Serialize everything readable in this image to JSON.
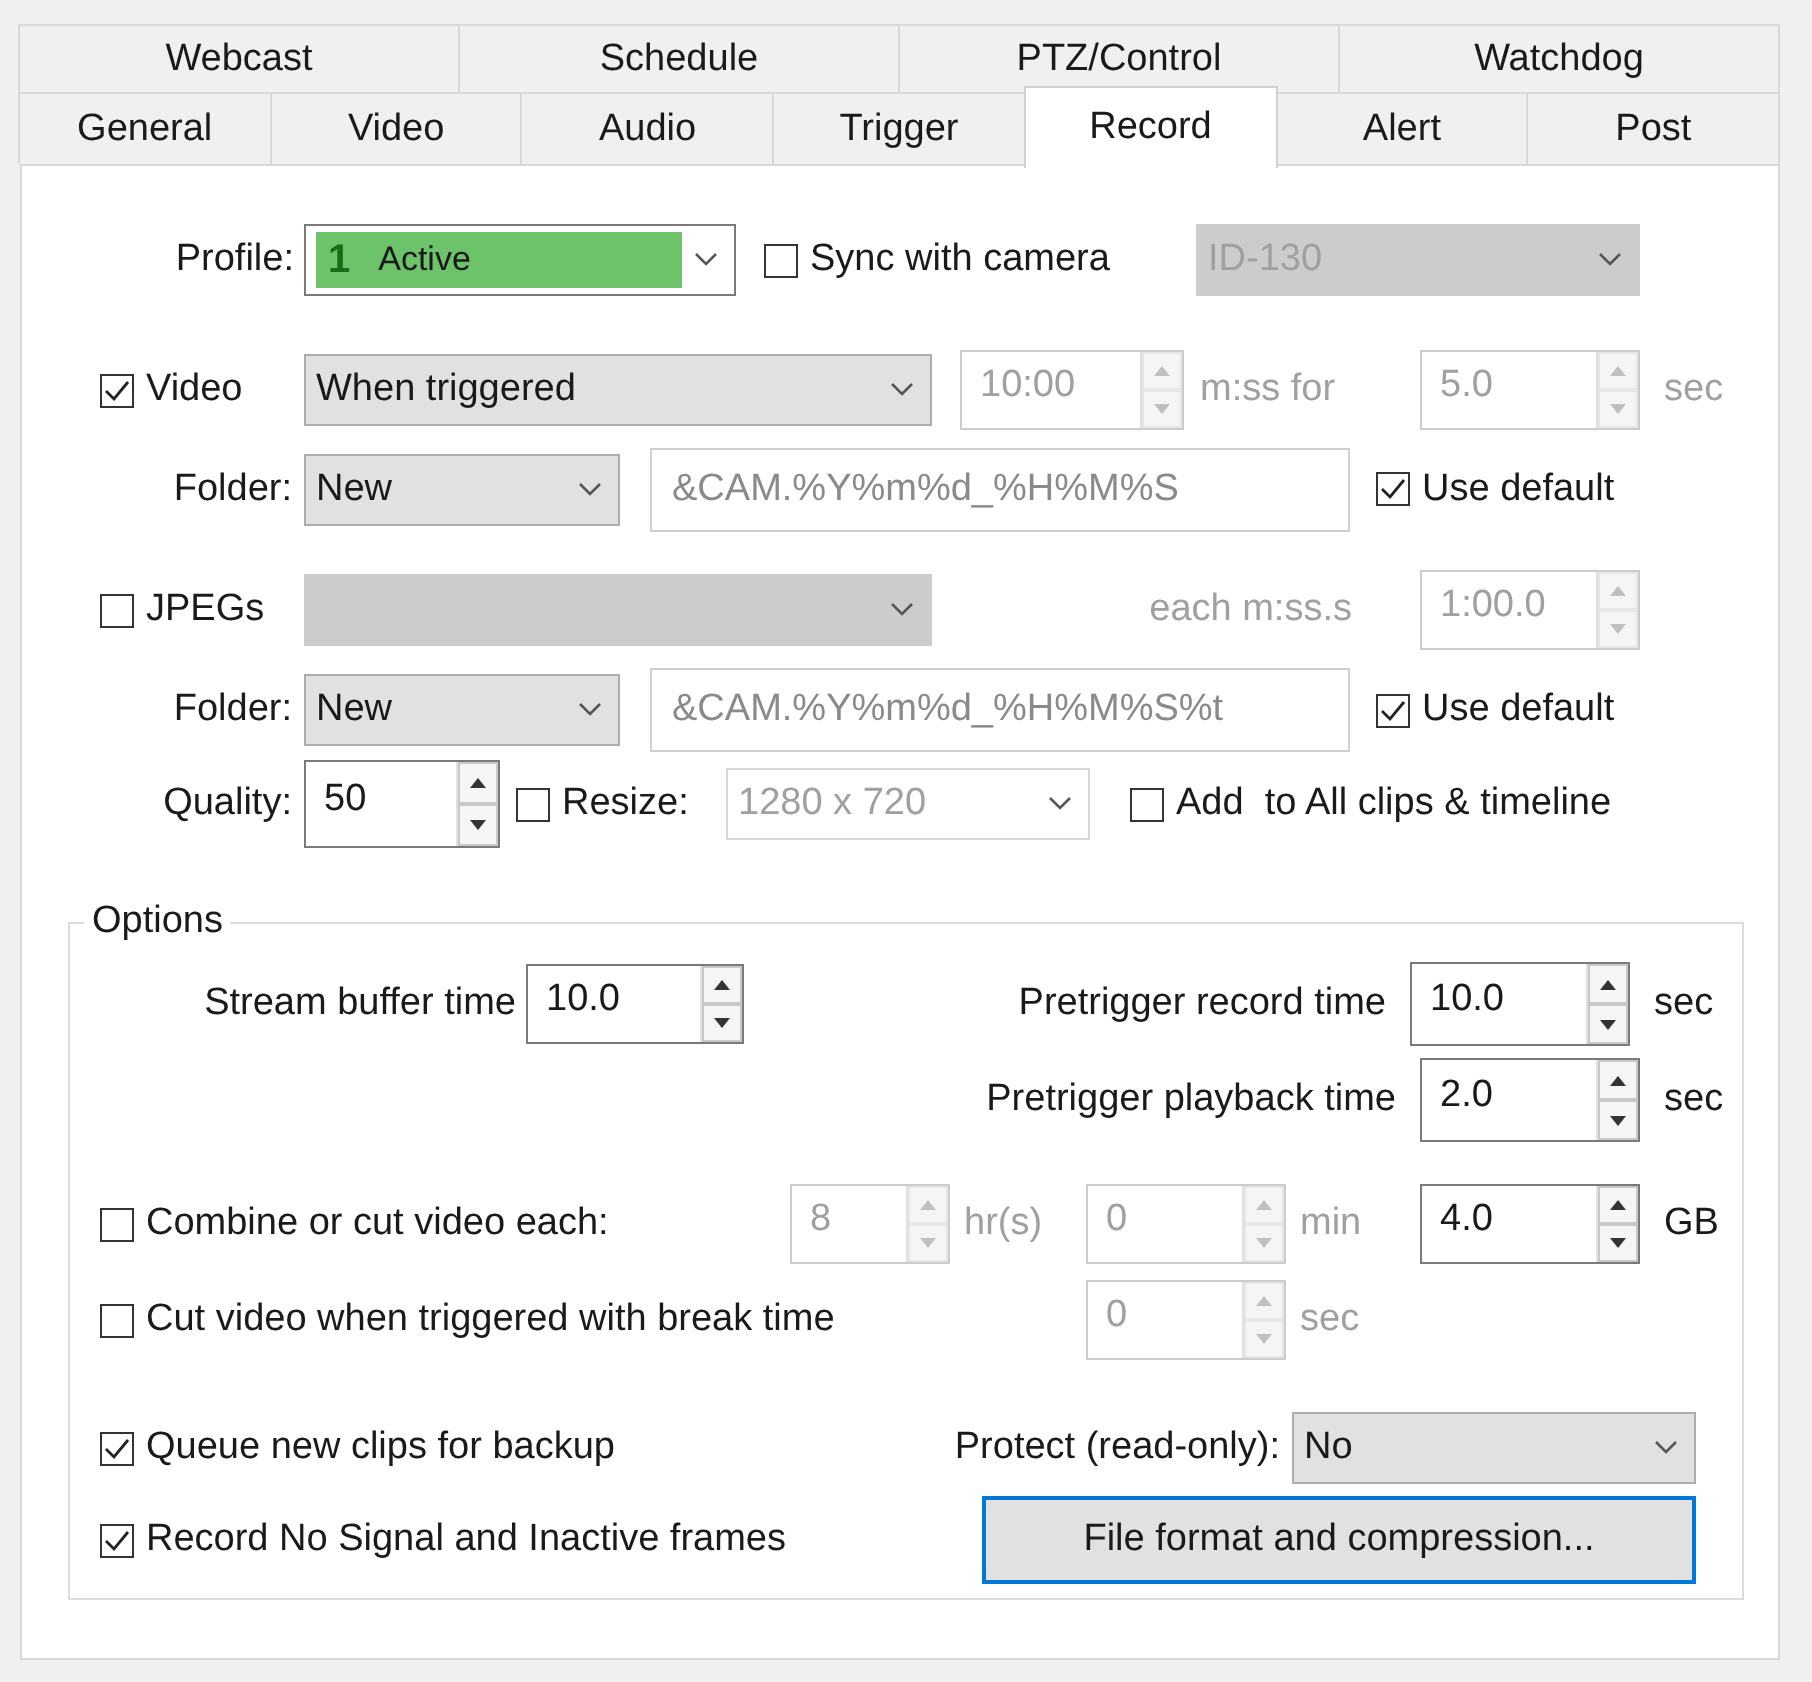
{
  "tabs": [
    [
      {
        "label": "Webcast",
        "selected": false
      },
      {
        "label": "Schedule",
        "selected": false
      },
      {
        "label": "PTZ/Control",
        "selected": false
      },
      {
        "label": "Watchdog",
        "selected": false
      }
    ],
    [
      {
        "label": "General",
        "selected": false
      },
      {
        "label": "Video",
        "selected": false
      },
      {
        "label": "Audio",
        "selected": false
      },
      {
        "label": "Trigger",
        "selected": false
      },
      {
        "label": "Record",
        "selected": true
      },
      {
        "label": "Alert",
        "selected": false
      },
      {
        "label": "Post",
        "selected": false
      }
    ]
  ],
  "profile": {
    "label": "Profile:",
    "badge": "1",
    "value": "Active",
    "sync": {
      "label": "Sync with camera",
      "checked": false
    },
    "camera": {
      "value": "ID-130",
      "disabled": true
    }
  },
  "video": {
    "enable": {
      "label": "Video",
      "checked": true
    },
    "mode": {
      "value": "When triggered",
      "disabled": false
    },
    "length": {
      "value": "10:00",
      "disabled": true
    },
    "length_unit": "m:ss for",
    "after": {
      "value": "5.0",
      "disabled": true
    },
    "after_unit": "sec",
    "folder_label": "Folder:",
    "folder": {
      "value": "New",
      "disabled": false
    },
    "path": {
      "value": "&CAM.%Y%m%d_%H%M%S",
      "disabled": true
    },
    "use_default": {
      "label": "Use default",
      "checked": true
    }
  },
  "jpegs": {
    "enable": {
      "label": "JPEGs",
      "checked": false
    },
    "mode": {
      "disabled": true
    },
    "interval_label": "each m:ss.s",
    "interval": {
      "value": "1:00.0",
      "disabled": true
    },
    "folder_label": "Folder:",
    "folder": {
      "value": "New",
      "disabled": false
    },
    "path": {
      "value": "&CAM.%Y%m%d_%H%M%S%t",
      "disabled": true
    },
    "use_default": {
      "label": "Use default",
      "checked": true
    },
    "quality_label": "Quality:",
    "quality": {
      "value": "50",
      "disabled": false
    },
    "resize": {
      "label": "Resize:",
      "checked": false
    },
    "size": {
      "value": "1280 x 720",
      "disabled": true
    },
    "add": {
      "label": "Add  to All clips & timeline",
      "checked": false
    }
  },
  "options": {
    "title": "Options",
    "stream_buffer": {
      "label": "Stream buffer time",
      "value": "10.0",
      "disabled": false
    },
    "pre_record": {
      "label": "Pretrigger record time",
      "value": "10.0",
      "unit": "sec",
      "disabled": false
    },
    "pre_playback": {
      "label": "Pretrigger playback time",
      "value": "2.0",
      "unit": "sec",
      "disabled": false
    },
    "combine": {
      "label": "Combine or cut video each:",
      "checked": false,
      "hours": {
        "value": "8",
        "disabled": true
      },
      "hours_unit": "hr(s)",
      "minutes": {
        "value": "0",
        "disabled": true
      },
      "minutes_unit": "min",
      "size": {
        "value": "4.0",
        "disabled": false
      },
      "size_unit": "GB"
    },
    "cut": {
      "label": "Cut video when triggered with break time",
      "checked": false,
      "break": {
        "value": "0",
        "disabled": true
      },
      "unit": "sec"
    },
    "queue": {
      "label": "Queue new clips for backup",
      "checked": true
    },
    "protect": {
      "label": "Protect (read-only):",
      "value": "No",
      "disabled": false
    },
    "record_no_signal": {
      "label": "Record No Signal and Inactive frames",
      "checked": true
    },
    "format_button": "File format and compression..."
  }
}
